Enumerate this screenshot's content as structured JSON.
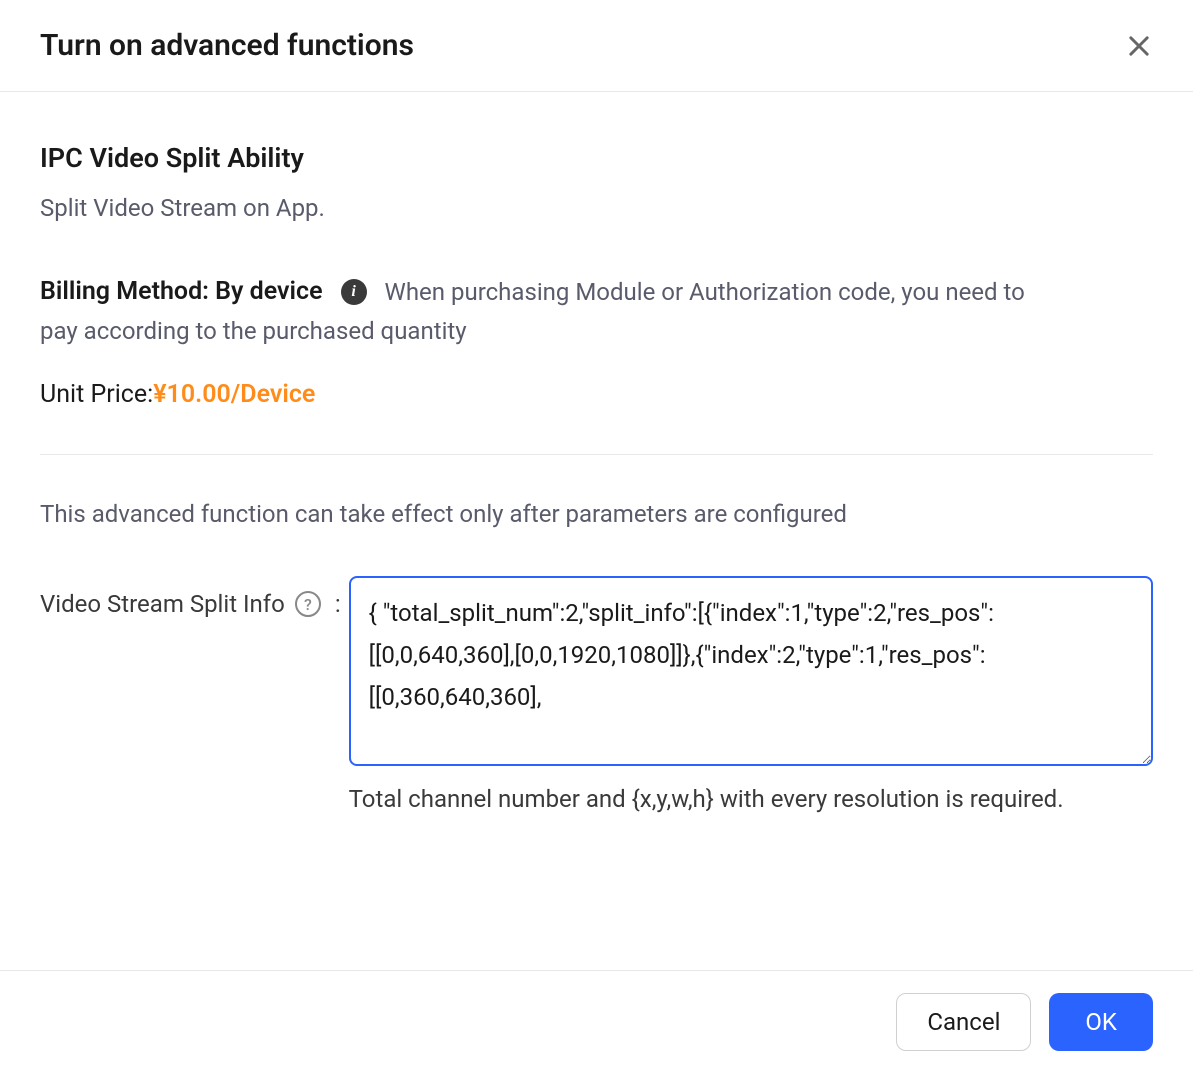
{
  "header": {
    "title": "Turn on advanced functions"
  },
  "feature": {
    "title": "IPC Video Split Ability",
    "description": "Split Video Stream on App."
  },
  "billing": {
    "label": "Billing Method: By device",
    "description_part1": "When purchasing Module or Authorization code, you need to ",
    "description_part2": "pay according to the purchased quantity"
  },
  "price": {
    "label": "Unit Price:",
    "value": "¥10.00/Device"
  },
  "configNote": "This advanced function can take effect only after parameters are configured",
  "form": {
    "label": "Video Stream Split Info",
    "value": "{ \"total_split_num\":2,\"split_info\":[{\"index\":1,\"type\":2,\"res_pos\":[[0,0,640,360],[0,0,1920,1080]]},{\"index\":2,\"type\":1,\"res_pos\":[[0,360,640,360],",
    "hint": "Total channel number and {x,y,w,h} with every resolution is required."
  },
  "footer": {
    "cancel": "Cancel",
    "ok": "OK"
  }
}
